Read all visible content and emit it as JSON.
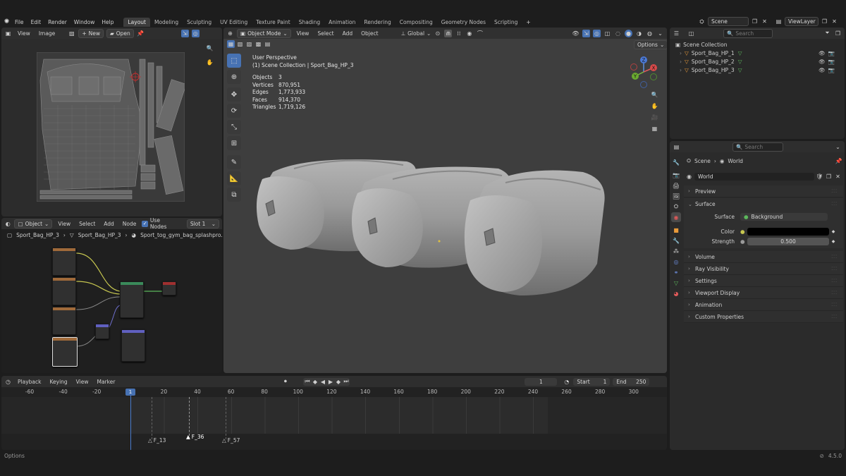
{
  "top_menu": {
    "file": "File",
    "edit": "Edit",
    "render": "Render",
    "window": "Window",
    "help": "Help",
    "workspaces": [
      "Layout",
      "Modeling",
      "Sculpting",
      "UV Editing",
      "Texture Paint",
      "Shading",
      "Animation",
      "Rendering",
      "Compositing",
      "Geometry Nodes",
      "Scripting"
    ],
    "add_workspace": "+",
    "scene_name": "Scene",
    "view_layer": "ViewLayer"
  },
  "image_editor": {
    "view": "View",
    "image": "Image",
    "new": "New",
    "open": "Open"
  },
  "viewport": {
    "mode": "Object Mode",
    "view": "View",
    "select": "Select",
    "add": "Add",
    "object": "Object",
    "transform": "Global",
    "options": "Options",
    "info_line1": "User Perspective",
    "info_line2": "(1) Scene Collection | Sport_Bag_HP_3",
    "stats": [
      {
        "label": "Objects",
        "value": "3"
      },
      {
        "label": "Vertices",
        "value": "870,951"
      },
      {
        "label": "Edges",
        "value": "1,773,933"
      },
      {
        "label": "Faces",
        "value": "914,370"
      },
      {
        "label": "Triangles",
        "value": "1,719,126"
      }
    ],
    "gizmo": {
      "x": "X",
      "y": "Y",
      "z": "Z"
    }
  },
  "outliner": {
    "search_placeholder": "Search",
    "root": "Scene Collection",
    "items": [
      "Sport_Bag_HP_1",
      "Sport_Bag_HP_2",
      "Sport_Bag_HP_3"
    ]
  },
  "node_editor": {
    "object": "Object",
    "view": "View",
    "select": "Select",
    "add": "Add",
    "node": "Node",
    "use_nodes": "Use Nodes",
    "slot": "Slot 1",
    "breadcrumb": [
      "Sport_Bag_HP_3",
      "Sport_Bag_HP_3",
      "Sport_tog_gym_bag_splashpro..."
    ]
  },
  "properties": {
    "search_placeholder": "Search",
    "crumb_scene": "Scene",
    "crumb_world": "World",
    "world_name": "World",
    "preview": "Preview",
    "surface_panel": "Surface",
    "surface_label": "Surface",
    "surface_value": "Background",
    "color_label": "Color",
    "strength_label": "Strength",
    "strength_value": "0.500",
    "color_value": "#000000",
    "panels": [
      "Volume",
      "Ray Visibility",
      "Settings",
      "Viewport Display",
      "Animation",
      "Custom Properties"
    ]
  },
  "timeline": {
    "playback": "Playback",
    "keying": "Keying",
    "view": "View",
    "marker": "Marker",
    "current_frame": "1",
    "start_label": "Start",
    "start": "1",
    "end_label": "End",
    "end": "250",
    "ruler": [
      "-60",
      "-40",
      "-20",
      "1",
      "20",
      "40",
      "60",
      "80",
      "100",
      "120",
      "140",
      "160",
      "180",
      "200",
      "220",
      "240",
      "260",
      "280",
      "300"
    ],
    "markers": [
      "F_13",
      "F_36",
      "F_57"
    ]
  },
  "status_bar": {
    "options": "Options",
    "version": "4.5.0"
  }
}
